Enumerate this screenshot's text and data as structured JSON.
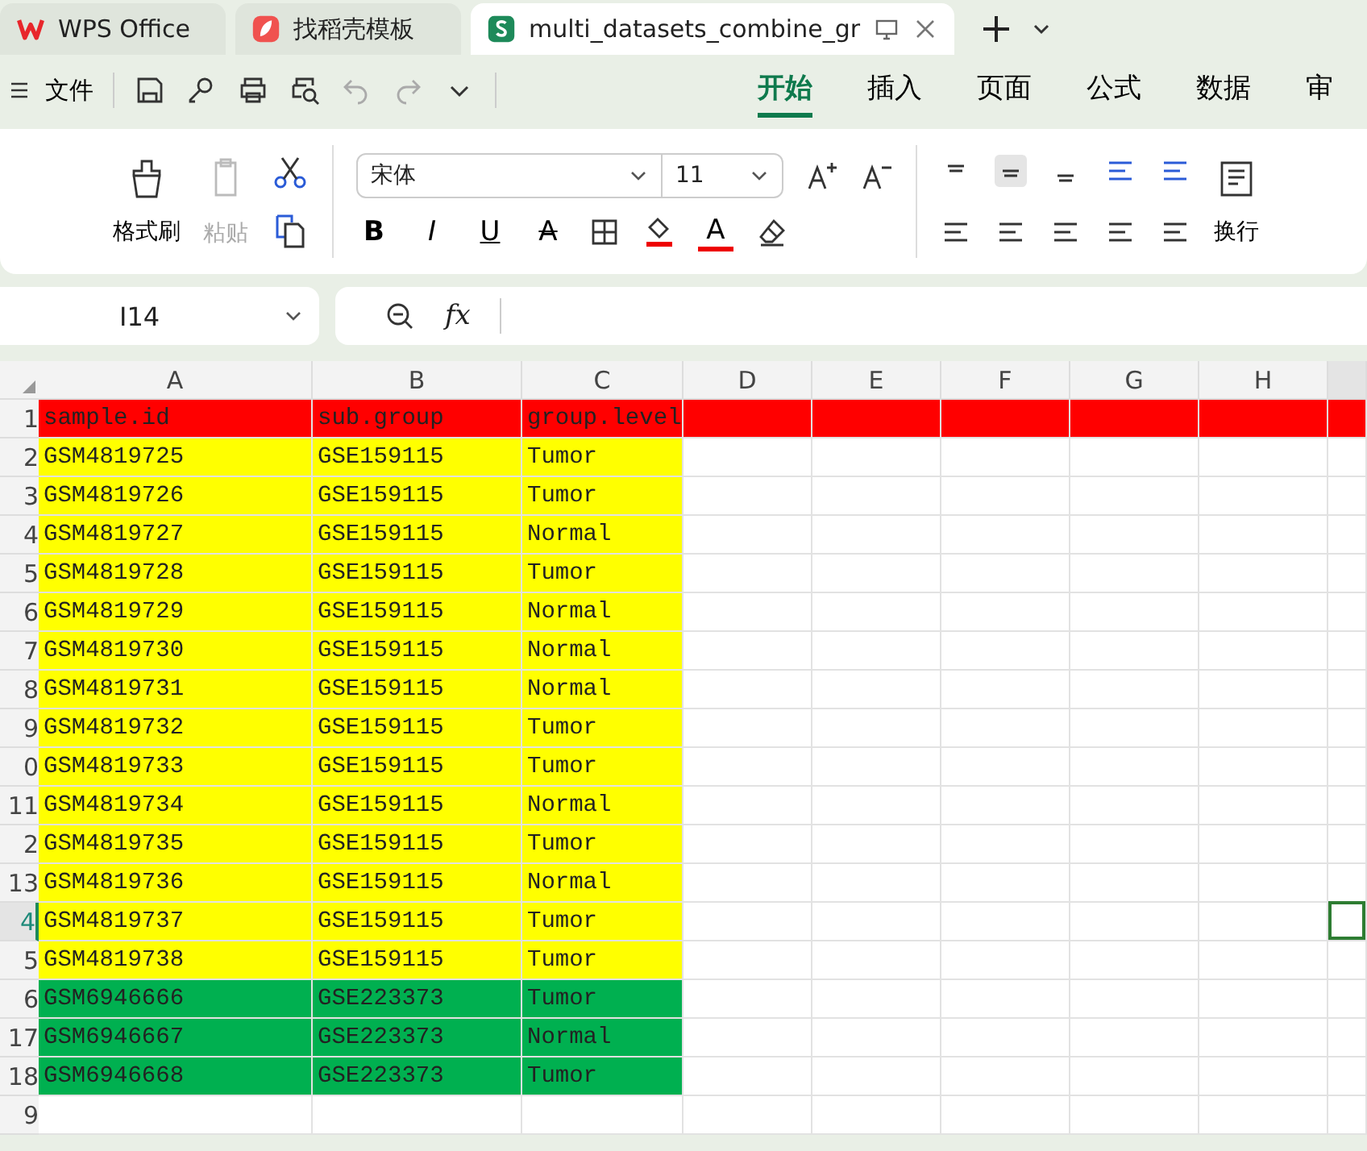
{
  "tabs": [
    {
      "label": "WPS Office",
      "kind": "wps",
      "selected": false
    },
    {
      "label": "找稻壳模板",
      "kind": "docer",
      "selected": false
    },
    {
      "label": "multi_datasets_combine_gr",
      "kind": "sheet",
      "selected": true
    }
  ],
  "menu": {
    "file": "文件",
    "tabs": [
      {
        "label": "开始",
        "selected": true
      },
      {
        "label": "插入",
        "selected": false
      },
      {
        "label": "页面",
        "selected": false
      },
      {
        "label": "公式",
        "selected": false
      },
      {
        "label": "数据",
        "selected": false
      },
      {
        "label": "审",
        "selected": false
      }
    ]
  },
  "ribbon": {
    "format_painter": "格式刷",
    "paste": {
      "label": "粘贴",
      "disabled": true
    },
    "font": "宋体",
    "size": "11",
    "format_buttons": [
      {
        "label": "B",
        "kind": "bold"
      },
      {
        "label": "I",
        "kind": "italic"
      },
      {
        "label": "U",
        "kind": "underline"
      },
      {
        "label": "A",
        "kind": "strike"
      }
    ],
    "fill_label": "A",
    "wrap": "换行"
  },
  "name_box": "I14",
  "formula_label": "fx",
  "columns": [
    {
      "label": "A",
      "selected": false
    },
    {
      "label": "B",
      "selected": false
    },
    {
      "label": "C",
      "selected": false
    },
    {
      "label": "D",
      "selected": false
    },
    {
      "label": "E",
      "selected": false
    },
    {
      "label": "F",
      "selected": false
    },
    {
      "label": "G",
      "selected": false
    },
    {
      "label": "H",
      "selected": false
    }
  ],
  "rows": [
    {
      "num": "1",
      "color": "#ff0000",
      "full": true,
      "selected": false,
      "cells": [
        "sample.id",
        "sub.group",
        "group.level"
      ]
    },
    {
      "num": "2",
      "color": "#ffff00",
      "full": false,
      "selected": false,
      "cells": [
        "GSM4819725",
        "GSE159115",
        "Tumor"
      ]
    },
    {
      "num": "3",
      "color": "#ffff00",
      "full": false,
      "selected": false,
      "cells": [
        "GSM4819726",
        "GSE159115",
        "Tumor"
      ]
    },
    {
      "num": "4",
      "color": "#ffff00",
      "full": false,
      "selected": false,
      "cells": [
        "GSM4819727",
        "GSE159115",
        "Normal"
      ]
    },
    {
      "num": "5",
      "color": "#ffff00",
      "full": false,
      "selected": false,
      "cells": [
        "GSM4819728",
        "GSE159115",
        "Tumor"
      ]
    },
    {
      "num": "6",
      "color": "#ffff00",
      "full": false,
      "selected": false,
      "cells": [
        "GSM4819729",
        "GSE159115",
        "Normal"
      ]
    },
    {
      "num": "7",
      "color": "#ffff00",
      "full": false,
      "selected": false,
      "cells": [
        "GSM4819730",
        "GSE159115",
        "Normal"
      ]
    },
    {
      "num": "8",
      "color": "#ffff00",
      "full": false,
      "selected": false,
      "cells": [
        "GSM4819731",
        "GSE159115",
        "Normal"
      ]
    },
    {
      "num": "9",
      "color": "#ffff00",
      "full": false,
      "selected": false,
      "cells": [
        "GSM4819732",
        "GSE159115",
        "Tumor"
      ]
    },
    {
      "num": "0",
      "color": "#ffff00",
      "full": false,
      "selected": false,
      "cells": [
        "GSM4819733",
        "GSE159115",
        "Tumor"
      ]
    },
    {
      "num": "11",
      "color": "#ffff00",
      "full": false,
      "selected": false,
      "cells": [
        "GSM4819734",
        "GSE159115",
        "Normal"
      ]
    },
    {
      "num": "2",
      "color": "#ffff00",
      "full": false,
      "selected": false,
      "cells": [
        "GSM4819735",
        "GSE159115",
        "Tumor"
      ]
    },
    {
      "num": "13",
      "color": "#ffff00",
      "full": false,
      "selected": false,
      "cells": [
        "GSM4819736",
        "GSE159115",
        "Normal"
      ]
    },
    {
      "num": "4",
      "color": "#ffff00",
      "full": false,
      "selected": true,
      "cells": [
        "GSM4819737",
        "GSE159115",
        "Tumor"
      ]
    },
    {
      "num": "5",
      "color": "#ffff00",
      "full": false,
      "selected": false,
      "cells": [
        "GSM4819738",
        "GSE159115",
        "Tumor"
      ]
    },
    {
      "num": "6",
      "color": "#00b050",
      "full": false,
      "selected": false,
      "cells": [
        "GSM6946666",
        "GSE223373",
        "Tumor"
      ]
    },
    {
      "num": "17",
      "color": "#00b050",
      "full": false,
      "selected": false,
      "cells": [
        "GSM6946667",
        "GSE223373",
        "Normal"
      ]
    },
    {
      "num": "18",
      "color": "#00b050",
      "full": false,
      "selected": false,
      "cells": [
        "GSM6946668",
        "GSE223373",
        "Tumor"
      ]
    },
    {
      "num": "9",
      "full": false,
      "selected": false
    }
  ]
}
